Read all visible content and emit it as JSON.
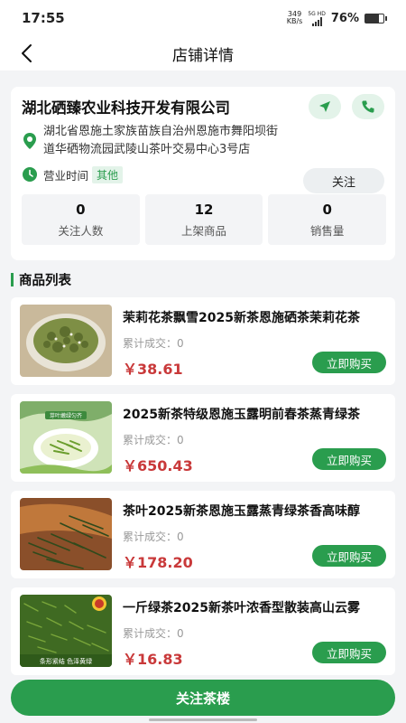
{
  "status": {
    "time": "17:55",
    "speed_value": "349",
    "speed_unit": "KB/s",
    "network": "5G HD",
    "battery": "76%",
    "battery_level": 0.76
  },
  "nav": {
    "title": "店铺详情",
    "back_icon": "chevron-left-icon"
  },
  "shop": {
    "name": "湖北硒臻农业科技开发有限公司",
    "address": "湖北省恩施土家族苗族自治州恩施市舞阳坝街道华硒物流园武陵山茶叶交易中心3号店",
    "hours_label": "营业时间",
    "hours_tag": "其他",
    "follow_label": "关注",
    "stats": [
      {
        "value": "0",
        "label": "关注人数"
      },
      {
        "value": "12",
        "label": "上架商品"
      },
      {
        "value": "0",
        "label": "销售量"
      }
    ]
  },
  "section": {
    "title": "商品列表"
  },
  "products": [
    {
      "title": "茉莉花茶飘雪2025新茶恩施硒茶茉莉花茶",
      "sales": "累计成交：0",
      "price": "￥38.61",
      "buy": "立即购买"
    },
    {
      "title": "2025新茶特级恩施玉露明前春茶蒸青绿茶",
      "sales": "累计成交：0",
      "price": "￥650.43",
      "buy": "立即购买",
      "thumb_text": "芽叶嫩绿匀齐"
    },
    {
      "title": "茶叶2025新茶恩施玉露蒸青绿茶香高味醇",
      "sales": "累计成交：0",
      "price": "￥178.20",
      "buy": "立即购买"
    },
    {
      "title": "一斤绿茶2025新茶叶浓香型散装高山云雾",
      "sales": "累计成交：0",
      "price": "￥16.83",
      "buy": "立即购买",
      "thumb_text": "条形紧结 色泽黄绿"
    }
  ],
  "bottom": {
    "follow_shop": "关注茶楼"
  },
  "colors": {
    "accent": "#2a9d4e",
    "price": "#c9393a",
    "background": "#f3f4f6"
  }
}
